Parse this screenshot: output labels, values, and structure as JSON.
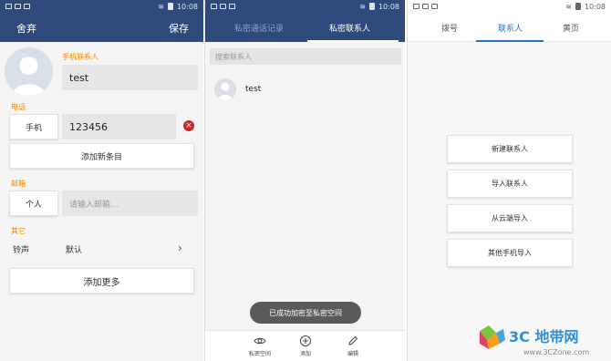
{
  "status": {
    "time": "10:08"
  },
  "edit_contact": {
    "cancel_label": "舍弃",
    "save_label": "保存",
    "phone_contact_label": "手机联系人",
    "name_value": "test",
    "phone_section_label": "电话",
    "phone_type": "手机",
    "phone_value": "123456",
    "add_entry_label": "添加新条目",
    "email_section_label": "邮箱",
    "email_type": "个人",
    "email_placeholder": "请输入邮箱...",
    "other_section_label": "其它",
    "ringtone_label": "铃声",
    "ringtone_value": "默认",
    "add_more_label": "添加更多"
  },
  "private_contacts": {
    "tabs": [
      "私密通话记录",
      "私密联系人"
    ],
    "active_tab": 1,
    "search_placeholder": "搜索联系人",
    "contacts": [
      {
        "name": "test"
      }
    ],
    "toast": "已成功加密至私密空间",
    "bottom_actions": [
      {
        "label": "私密空间",
        "icon": "eye-icon"
      },
      {
        "label": "添加",
        "icon": "add-circle-icon"
      },
      {
        "label": "编辑",
        "icon": "pencil-icon"
      }
    ]
  },
  "contacts_menu": {
    "tabs": [
      "拨号",
      "联系人",
      "黄页"
    ],
    "active_tab": 1,
    "items": [
      "新建联系人",
      "导入联系人",
      "从云端导入",
      "其他手机导入"
    ]
  },
  "watermark": {
    "brand": "3C 地带网",
    "url": "www.3CZone.com"
  },
  "colors": {
    "header_blue": "#2d4a7a",
    "accent_orange": "#f08a00",
    "tab_active_blue": "#2a6fd6",
    "delete_red": "#c62828"
  }
}
